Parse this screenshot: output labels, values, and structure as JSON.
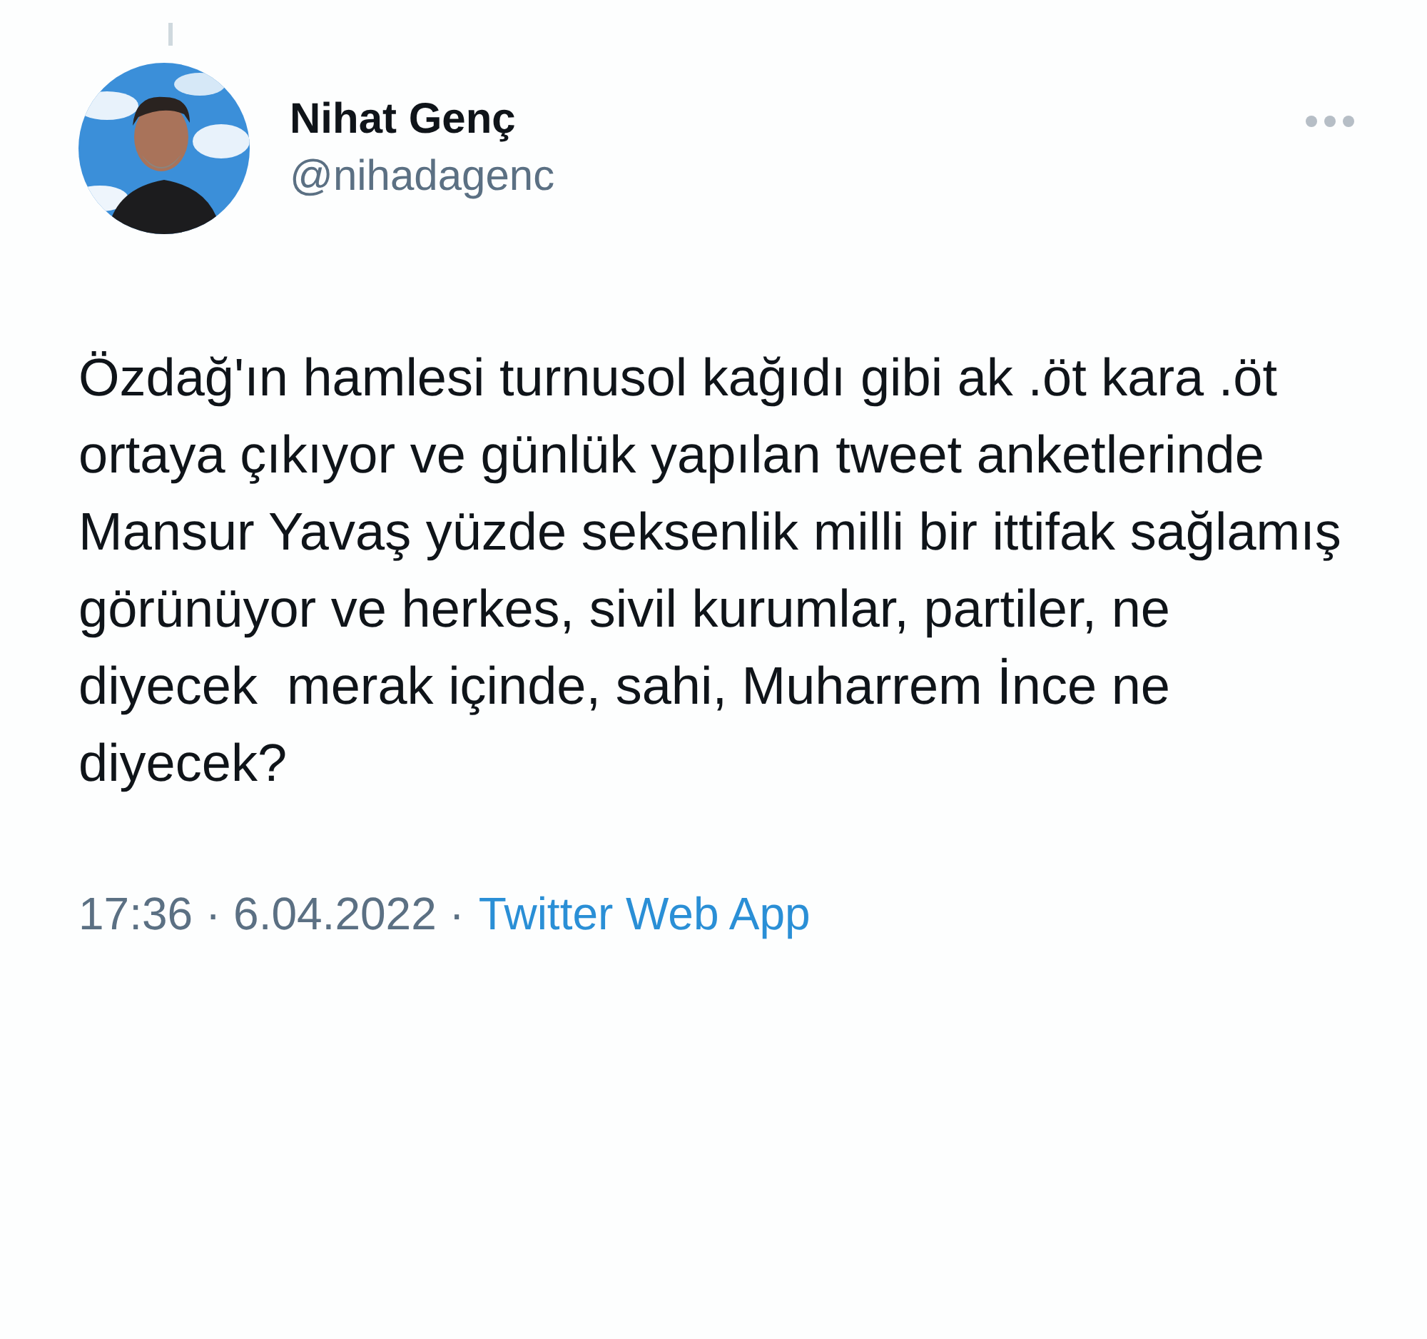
{
  "author": {
    "name": "Nihat Genç",
    "handle": "@nihadagenc"
  },
  "tweet": {
    "text": "Özdağ'ın hamlesi turnusol kağıdı gibi ak .öt kara .öt ortaya çıkıyor ve günlük yapılan tweet anketlerinde Mansur Yavaş yüzde seksenlik milli bir ittifak sağlamış görünüyor ve herkes, sivil kurumlar, partiler, ne diyecek  merak içinde, sahi, Muharrem İnce ne diyecek?"
  },
  "footer": {
    "timestamp": "17:36 · 6.04.2022 ·",
    "source": "Twitter Web App"
  }
}
